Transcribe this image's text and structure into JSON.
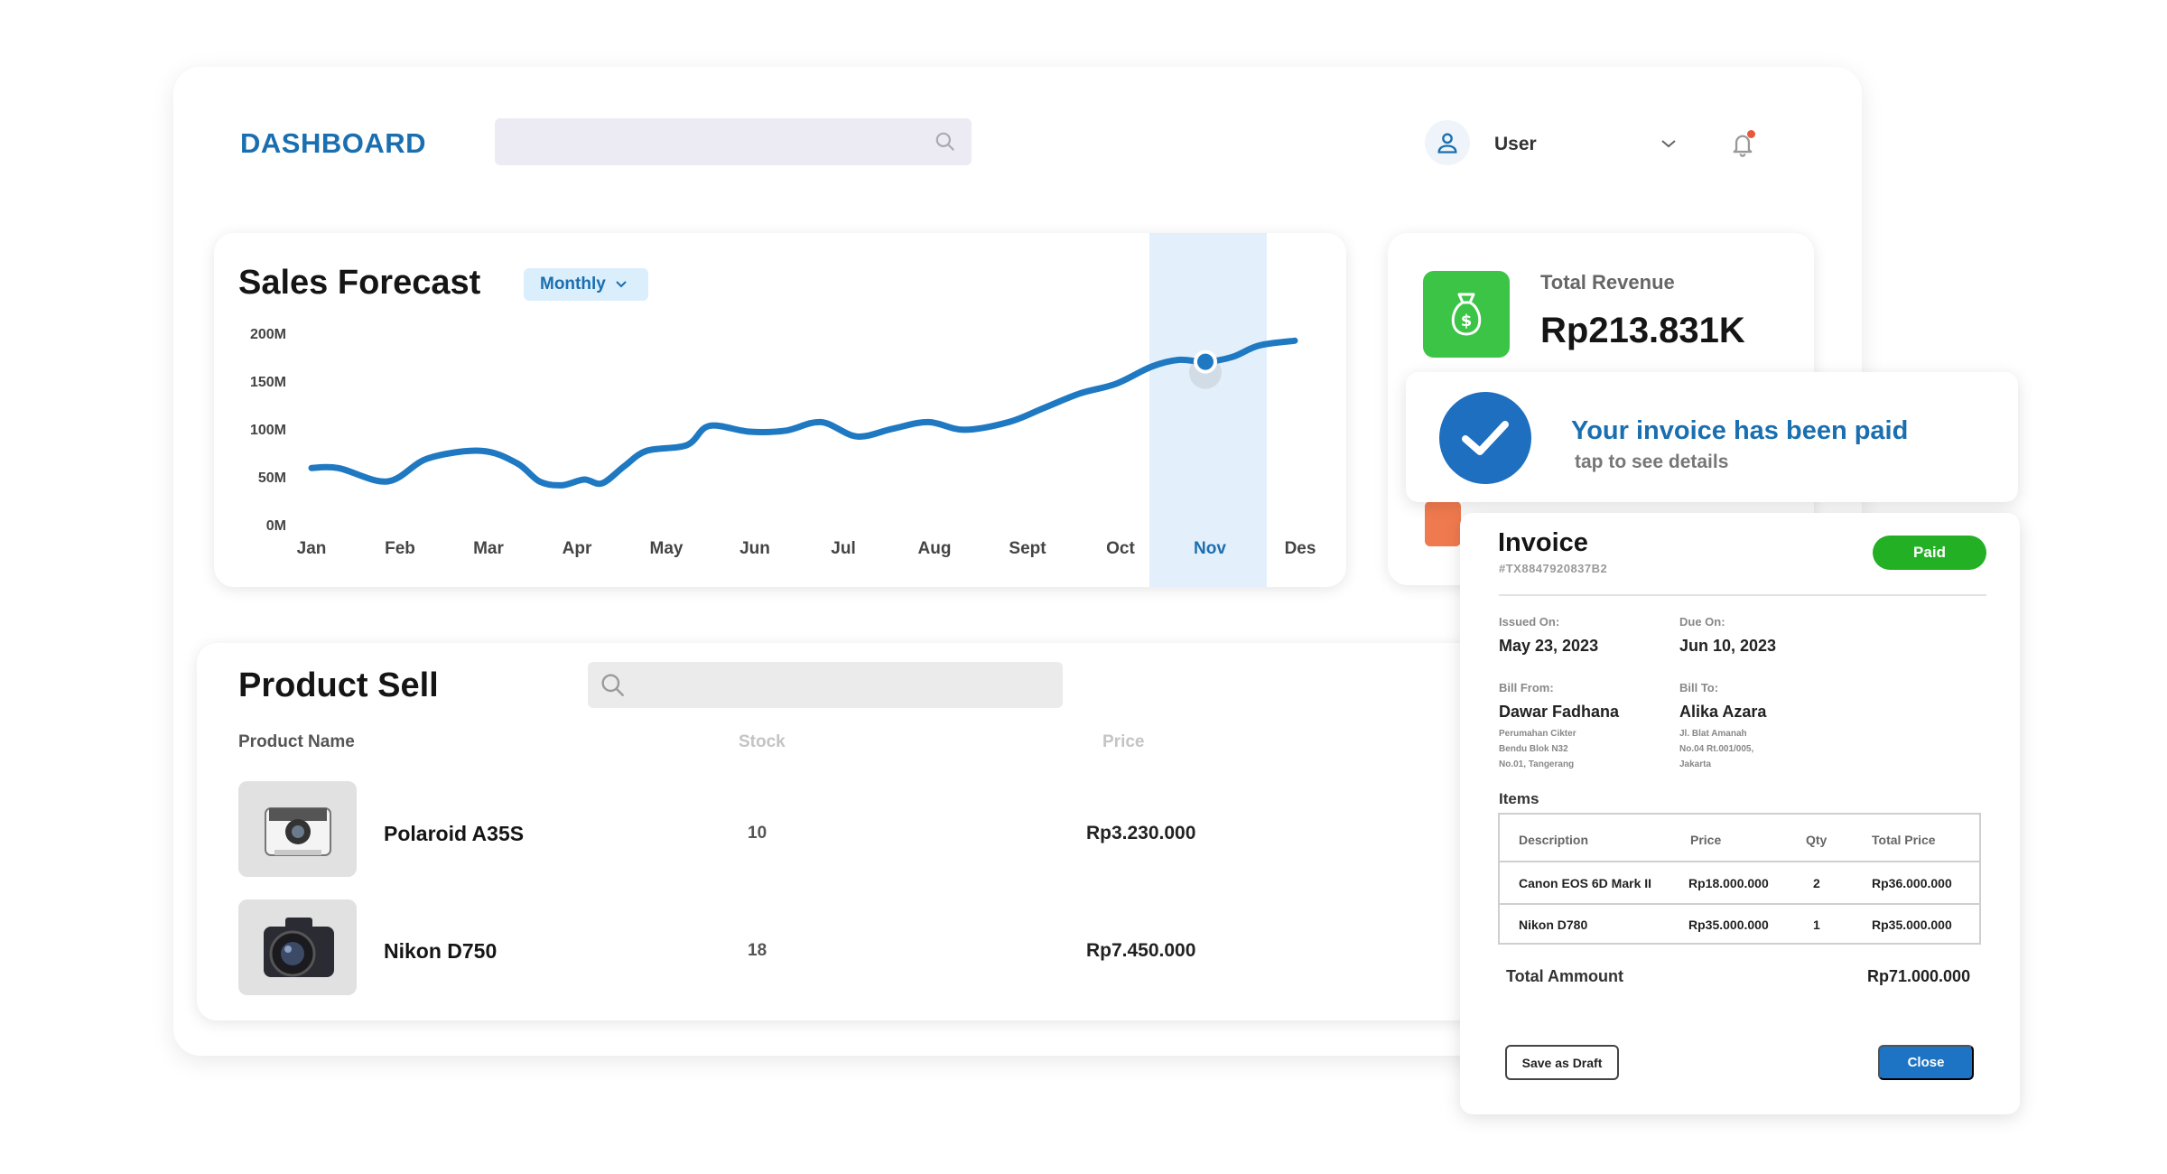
{
  "header": {
    "brand": "DASHBOARD",
    "search_placeholder": "",
    "user_name": "User"
  },
  "sales": {
    "title": "Sales Forecast",
    "period": "Monthly"
  },
  "chart_data": {
    "type": "line",
    "title": "Sales Forecast",
    "xlabel": "",
    "ylabel": "",
    "categories": [
      "Jan",
      "Feb",
      "Mar",
      "Apr",
      "May",
      "Jun",
      "Jul",
      "Aug",
      "Sept",
      "Oct",
      "Nov",
      "Des"
    ],
    "y_ticks": [
      "200M",
      "150M",
      "100M",
      "50M",
      "0M"
    ],
    "ylim": [
      0,
      200
    ],
    "highlighted_category": "Nov",
    "grid": false,
    "x": [
      0,
      0.3,
      0.85,
      1.3,
      1.9,
      2.3,
      2.55,
      2.8,
      3.05,
      3.25,
      3.5,
      3.75,
      4.2,
      4.45,
      4.9,
      5.3,
      5.7,
      6.1,
      6.5,
      6.9,
      7.3,
      7.8,
      8.2,
      8.6,
      9.0,
      9.4,
      9.7,
      10.0,
      10.3,
      10.6,
      11.0
    ],
    "values": [
      62,
      62,
      48,
      72,
      80,
      67,
      48,
      44,
      50,
      46,
      64,
      80,
      86,
      106,
      100,
      101,
      110,
      95,
      103,
      110,
      102,
      110,
      125,
      140,
      150,
      168,
      175,
      173,
      178,
      190,
      195
    ]
  },
  "revenue": {
    "label": "Total Revenue",
    "value": "Rp213.831K",
    "icon": "money-bag-icon",
    "color": "#3cc447"
  },
  "notification": {
    "title": "Your invoice has been paid",
    "subtitle": "tap to see details"
  },
  "product": {
    "title": "Product Sell",
    "search_placeholder": "",
    "columns": [
      "Product Name",
      "Stock",
      "Price"
    ],
    "rows": [
      {
        "name": "Polaroid A35S",
        "stock": "10",
        "price": "Rp3.230.000"
      },
      {
        "name": "Nikon D750",
        "stock": "18",
        "price": "Rp7.450.000"
      }
    ]
  },
  "invoice": {
    "title": "Invoice",
    "id": "#TX8847920837B2",
    "status": "Paid",
    "issued_label": "Issued On:",
    "issued": "May 23, 2023",
    "due_label": "Due On:",
    "due": "Jun 10, 2023",
    "from_label": "Bill From:",
    "from_name": "Dawar Fadhana",
    "from_addr": [
      "Perumahan Cikter",
      "Bendu Blok N32",
      "No.01, Tangerang"
    ],
    "to_label": "Bill To:",
    "to_name": "Alika Azara",
    "to_addr": [
      "Jl. Blat Amanah",
      "No.04 Rt.001/005,",
      "Jakarta"
    ],
    "items_label": "Items",
    "item_columns": [
      "Description",
      "Price",
      "Qty",
      "Total Price"
    ],
    "items": [
      {
        "desc": "Canon EOS 6D Mark II",
        "price": "Rp18.000.000",
        "qty": "2",
        "total": "Rp36.000.000"
      },
      {
        "desc": "Nikon D780",
        "price": "Rp35.000.000",
        "qty": "1",
        "total": "Rp35.000.000"
      }
    ],
    "total_label": "Total Ammount",
    "total": "Rp71.000.000",
    "draft_label": "Save as Draft",
    "close_label": "Close",
    "accent": "#1e74c4",
    "paid_color": "#23b024"
  }
}
